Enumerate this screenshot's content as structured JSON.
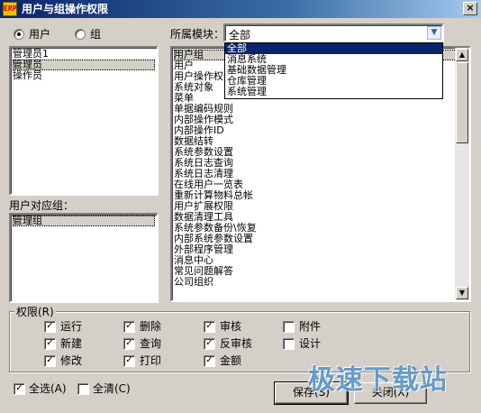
{
  "window": {
    "title": "用户与组操作权限",
    "app_icon": "ERP",
    "close": "×"
  },
  "target_type": {
    "user": "用户",
    "group": "组",
    "selected": "user"
  },
  "users": [
    "管理员1",
    "管理员",
    "操作员"
  ],
  "group_label": "用户对应组：",
  "groups": [
    "管理组"
  ],
  "module": {
    "label": "所属模块：",
    "value": "全部",
    "options": [
      "全部",
      "消息系统",
      "基础数据管理",
      "仓库管理",
      "系统管理"
    ]
  },
  "functions": [
    "用户组",
    "用户",
    "用户操作权",
    "系统对象",
    "菜单",
    "单据编码规则",
    "内部操作模式",
    "内部操作ID",
    "数据结转",
    "系统参数设置",
    "系统日志查询",
    "系统日志清理",
    "在线用户一览表",
    "重新计算物料总帐",
    "用户扩展权限",
    "数据清理工具",
    "系统参数备份\\恢复",
    "内部系统参数设置",
    "外部程序管理",
    "消息中心",
    "常见问题解答",
    "公司组织"
  ],
  "permissions": {
    "label": "权限(R)",
    "items": [
      {
        "label": "运行",
        "checked": true
      },
      {
        "label": "删除",
        "checked": true
      },
      {
        "label": "审核",
        "checked": true
      },
      {
        "label": "附件",
        "checked": false
      },
      {
        "label": "新建",
        "checked": true
      },
      {
        "label": "查询",
        "checked": true
      },
      {
        "label": "反审核",
        "checked": true
      },
      {
        "label": "设计",
        "checked": false
      },
      {
        "label": "修改",
        "checked": true
      },
      {
        "label": "打印",
        "checked": true
      },
      {
        "label": "金额",
        "checked": true
      }
    ]
  },
  "footer": {
    "select_all": "全选(A)",
    "select_all_checked": true,
    "clear_all": "全清(C)",
    "clear_all_checked": false,
    "save": "保存(S)",
    "close": "关闭(X)"
  },
  "watermark": "极速下载站",
  "colors": {
    "titlebar": "#0a246a",
    "face": "#d4d0c8",
    "highlight": "#0a246a"
  }
}
